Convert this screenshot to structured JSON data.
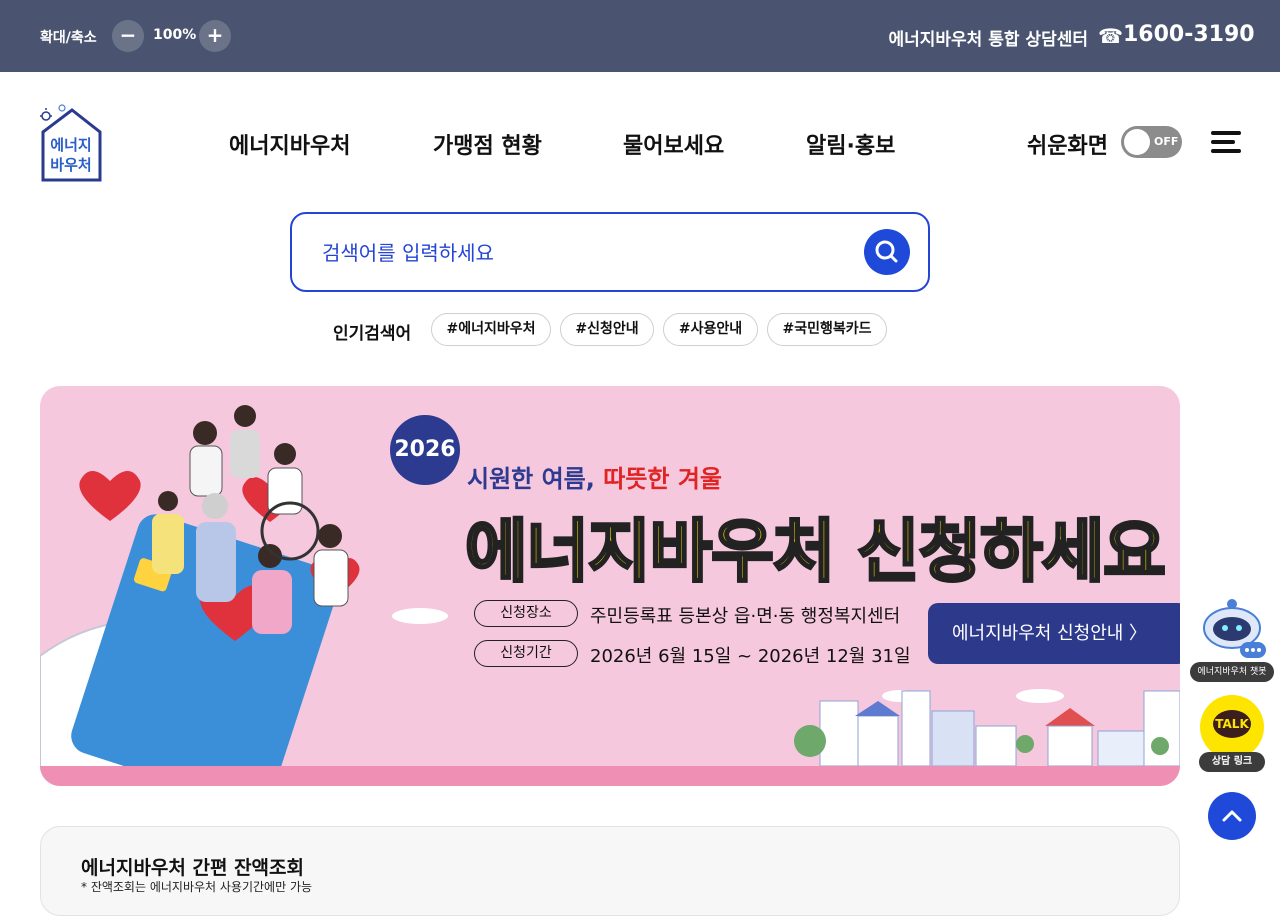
{
  "topbar": {
    "zoom_label": "확대/축소",
    "zoom_out": "−",
    "zoom_value": "100%",
    "zoom_in": "+",
    "center_label": "에너지바우처 통합 상담센터",
    "phone_icon": "☎",
    "phone_number": "1600-3190",
    "background": "#4a5470"
  },
  "header": {
    "logo_text_line1": "에너지",
    "logo_text_line2": "바우처",
    "nav": [
      "에너지바우처",
      "가맹점 현황",
      "물어보세요",
      "알림·홍보"
    ],
    "easy_mode_label": "쉬운화면",
    "easy_mode_state": "OFF",
    "menu_icon": "hamburger-menu-icon"
  },
  "search": {
    "placeholder": "검색어를 입력하세요",
    "button_icon": "search-icon",
    "accent": "#2545d4"
  },
  "popular": {
    "label": "인기검색어",
    "tags": [
      "#에너지바우처",
      "#신청안내",
      "#사용안내",
      "#국민행복카드"
    ]
  },
  "banner": {
    "year": "2026",
    "slogan_part1": "시원한 여름, ",
    "slogan_part2": "따뜻한 겨울",
    "headline": "에너지바우처 신청하세요",
    "place_label": "신청장소",
    "place_value": "주민등록표 등본상 읍·면·동 행정복지센터",
    "period_label": "신청기간",
    "period_value": "2026년 6월 15일 ~ 2026년 12월 31일",
    "cta": "에너지바우처 신청안내 〉",
    "background": "#f6c8de"
  },
  "floating": {
    "chatbot_label": "에너지바우처 챗봇",
    "kakao_bubble": "TALK",
    "kakao_label": "상담 링크",
    "top_icon": "arrow-up-icon"
  },
  "balance": {
    "title": "에너지바우처 간편 잔액조회",
    "note": "* 잔액조회는 에너지바우처 사용기간에만 가능"
  }
}
